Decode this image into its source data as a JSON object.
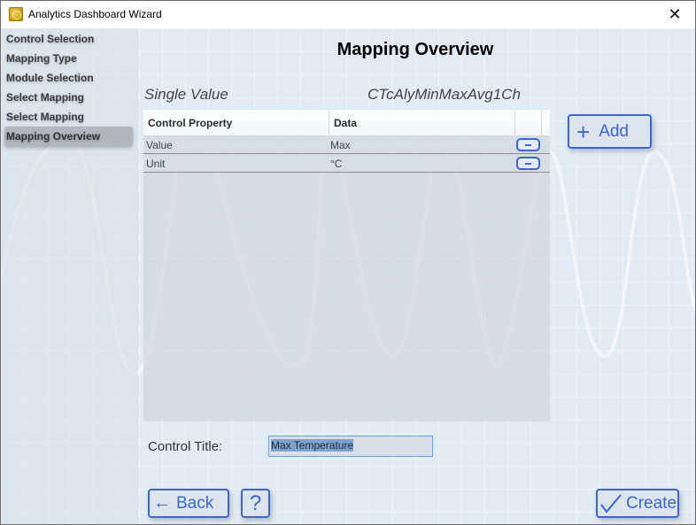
{
  "window": {
    "title": "Analytics Dashboard Wizard",
    "app_icon": "gear-app-icon",
    "close_icon": "close-icon"
  },
  "sidebar": {
    "items": [
      {
        "label": "Control Selection",
        "active": false
      },
      {
        "label": "Mapping Type",
        "active": false
      },
      {
        "label": "Module Selection",
        "active": false
      },
      {
        "label": "Select Mapping",
        "active": false
      },
      {
        "label": "Select Mapping",
        "active": false
      },
      {
        "label": "Mapping Overview",
        "active": true
      }
    ]
  },
  "main": {
    "title": "Mapping Overview",
    "mapping_type": "Single Value",
    "module_name": "CTcAlyMinMaxAvg1Ch",
    "grid": {
      "columns": [
        "Control Property",
        "Data",
        ""
      ],
      "rows": [
        {
          "property": "Value",
          "data": "Max",
          "remove_icon": "minus-icon"
        },
        {
          "property": "Unit",
          "data": "°C",
          "remove_icon": "minus-icon"
        }
      ]
    },
    "add_button": {
      "label": "Add",
      "icon": "plus-icon"
    },
    "control_title": {
      "label": "Control Title:",
      "value": "Max Temperature"
    }
  },
  "footer": {
    "back_button": {
      "label": "Back",
      "icon": "arrow-left-icon"
    },
    "help_button": {
      "label": "?"
    },
    "create_button": {
      "label": "Create",
      "icon": "checkmark-icon"
    }
  },
  "colors": {
    "accent": "#3b64d8",
    "background": "#e1ebf4",
    "selection": "#7ba3cd",
    "active_nav": "#b3b7bb"
  }
}
